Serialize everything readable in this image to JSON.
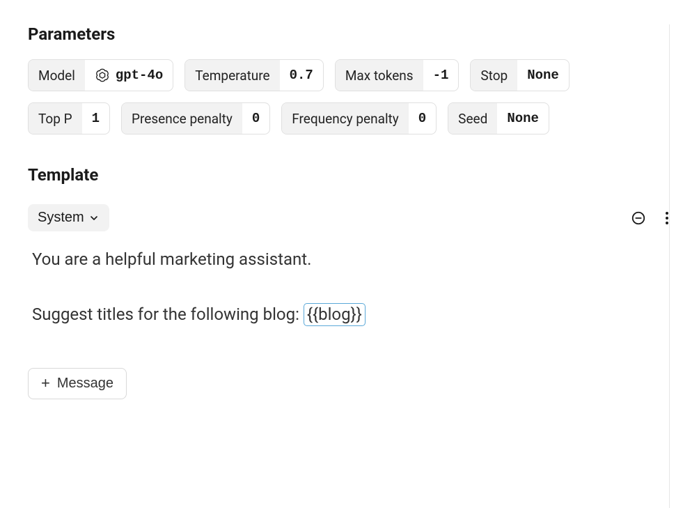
{
  "sections": {
    "parameters_title": "Parameters",
    "template_title": "Template"
  },
  "parameters": {
    "model": {
      "label": "Model",
      "value": "gpt-4o"
    },
    "temperature": {
      "label": "Temperature",
      "value": "0.7"
    },
    "max_tokens": {
      "label": "Max tokens",
      "value": "-1"
    },
    "stop": {
      "label": "Stop",
      "value": "None"
    },
    "top_p": {
      "label": "Top P",
      "value": "1"
    },
    "presence_penalty": {
      "label": "Presence penalty",
      "value": "0"
    },
    "frequency_penalty": {
      "label": "Frequency penalty",
      "value": "0"
    },
    "seed": {
      "label": "Seed",
      "value": "None"
    }
  },
  "template": {
    "role_label": "System",
    "message_line1": "You are a helpful marketing assistant.",
    "message_line2_prefix": "Suggest titles for the following blog: ",
    "variable": "{{blog}}",
    "add_message_label": "Message"
  }
}
